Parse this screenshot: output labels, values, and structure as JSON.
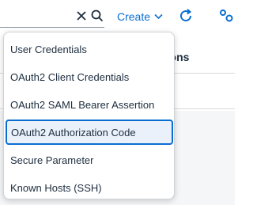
{
  "toolbar": {
    "search_value": "",
    "create_label": "Create",
    "icons": [
      "close-icon",
      "search-icon",
      "chevron-down-icon",
      "refresh-icon",
      "settings-icon"
    ]
  },
  "table": {
    "visible_header_fragment": "tions"
  },
  "menu": {
    "items": [
      "User Credentials",
      "OAuth2 Client Credentials",
      "OAuth2 SAML Bearer Assertion",
      "OAuth2 Authorization Code",
      "Secure Parameter",
      "Known Hosts (SSH)"
    ],
    "selected_index": 3
  },
  "colors": {
    "accent": "#0a6ed1",
    "text": "#1d2d3e",
    "border": "#cfd3d6"
  }
}
